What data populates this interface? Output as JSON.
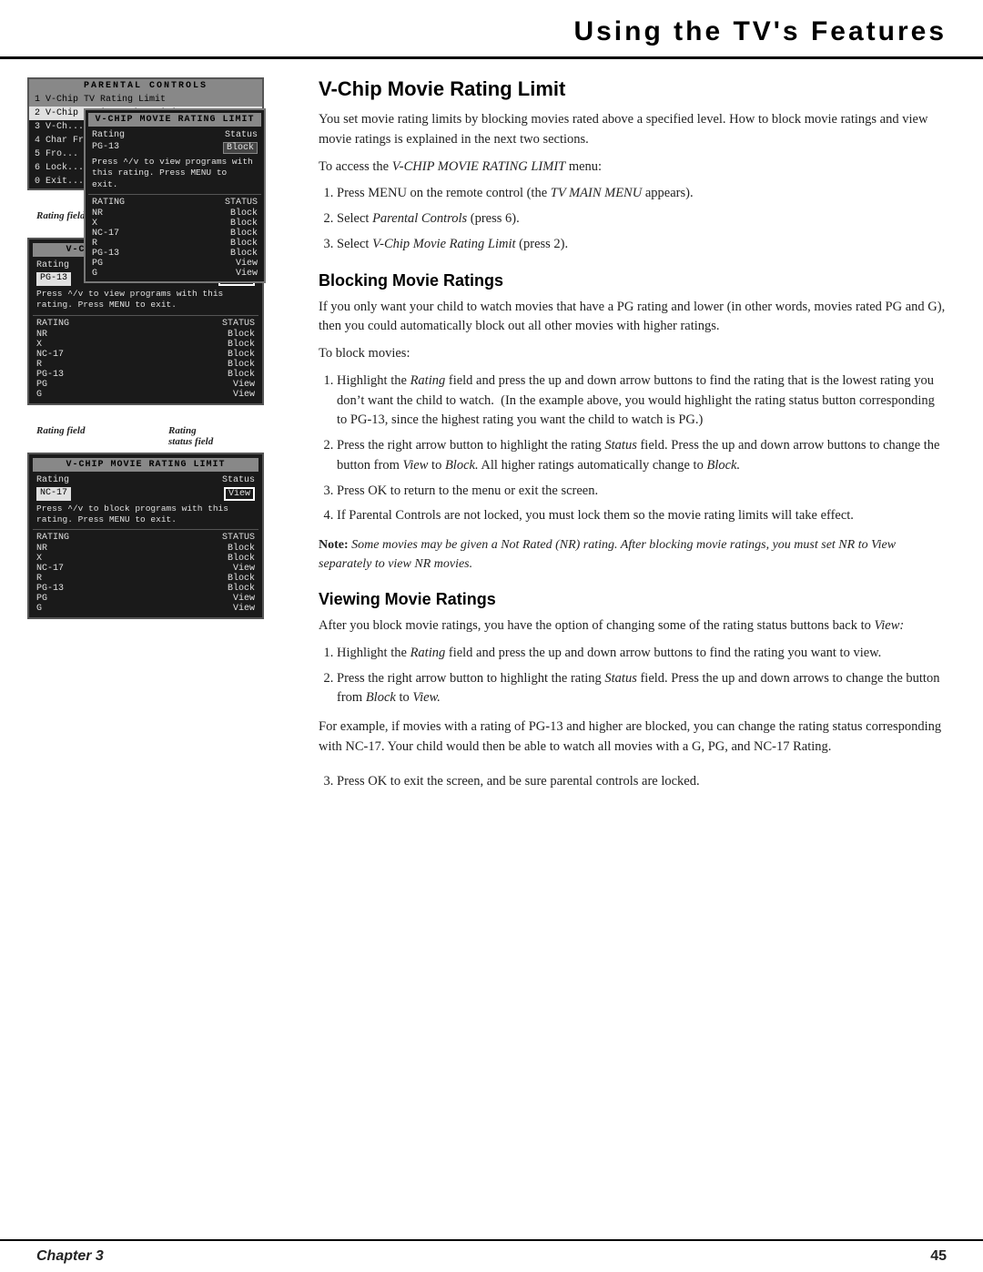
{
  "header": {
    "title": "Using the TV's Features"
  },
  "footer": {
    "chapter": "Chapter 3",
    "page": "45"
  },
  "main_section": {
    "title": "V-Chip Movie Rating Limit",
    "intro": "You set movie rating limits by blocking movies rated above a specified level. How to block movie ratings and view movie ratings is explained in the next two sections.",
    "access_label": "To access the V-CHIP MOVIE RATING LIMIT menu:",
    "access_steps": [
      "Press MENU on the remote control (the TV MAIN MENU appears).",
      "Select Parental Controls (press 6).",
      "Select V-Chip Movie Rating Limit (press 2)."
    ]
  },
  "blocking_section": {
    "title": "Blocking Movie Ratings",
    "intro": "If you only want your child to watch movies that have a PG rating and lower (in other words, movies rated PG and G), then you could automatically block out all other movies with higher ratings.",
    "to_block": "To block movies:",
    "steps": [
      "Highlight the Rating field and press the up and down arrow buttons to find the rating that is the lowest rating you don't want the child to watch.  (In the example above, you would highlight the rating status button corresponding to PG-13, since the highest rating you want the child to watch is PG.)",
      "Press the right arrow button to highlight the rating Status field. Press the up and down arrow buttons to change the button from View to Block. All higher ratings automatically change to Block.",
      "Press OK to return to the menu or exit the screen.",
      "If Parental Controls are not locked, you must lock them so the movie rating limits will take effect."
    ],
    "note": "Note: Some movies may be given a Not Rated (NR) rating. After blocking movie ratings, you must set NR to View separately to view NR movies."
  },
  "viewing_section": {
    "title": "Viewing Movie Ratings",
    "intro": "After you block movie ratings, you have the option of changing some of the rating status buttons back to View:",
    "steps": [
      "Highlight the Rating field and press the up and down arrow buttons to find the rating you want to view.",
      "Press the right arrow button to highlight the rating Status field. Press the up and down arrows to change the button from Block to View."
    ],
    "example": "For example, if movies with a rating of PG-13 and higher are blocked, you can change the rating status corresponding with NC-17. Your child would then be able to watch all movies with a G, PG, and NC-17 Rating.",
    "step3": "Press OK to exit the screen, and be sure parental controls are locked."
  },
  "parental_menu": {
    "title": "PARENTAL CONTROLS",
    "items": [
      "1 V-Chip TV Rating Limit",
      "2 V-Chip Movie Rating Limit",
      "3 V-Ch...",
      "4 Cha...",
      "5 Fro...",
      "6 Lock...",
      "0 Exit..."
    ]
  },
  "vchip_screen": {
    "title": "V-CHIP MOVIE RATING LIMIT",
    "col1": "Rating",
    "col2": "Status",
    "current_rating": "PG-13",
    "current_status_block": "Block",
    "info_text": "Press ^/v to view programs with this rating. Press MENU to exit.",
    "ratings": [
      "NR",
      "X",
      "NC-17",
      "R",
      "PG-13",
      "PG",
      "G"
    ],
    "statuses_block1": [
      "Block",
      "Block",
      "Block",
      "Block",
      "Block",
      "View",
      "View"
    ],
    "statuses_block2": [
      "Block",
      "Block",
      "Block",
      "Block",
      "Block",
      "View",
      "View"
    ],
    "statuses_view": [
      "Block",
      "Block",
      "View",
      "Block",
      "Block",
      "View",
      "View"
    ]
  },
  "labels": {
    "rating_field": "Rating field",
    "rating_status_field": "Rating",
    "status_field": "status field"
  }
}
